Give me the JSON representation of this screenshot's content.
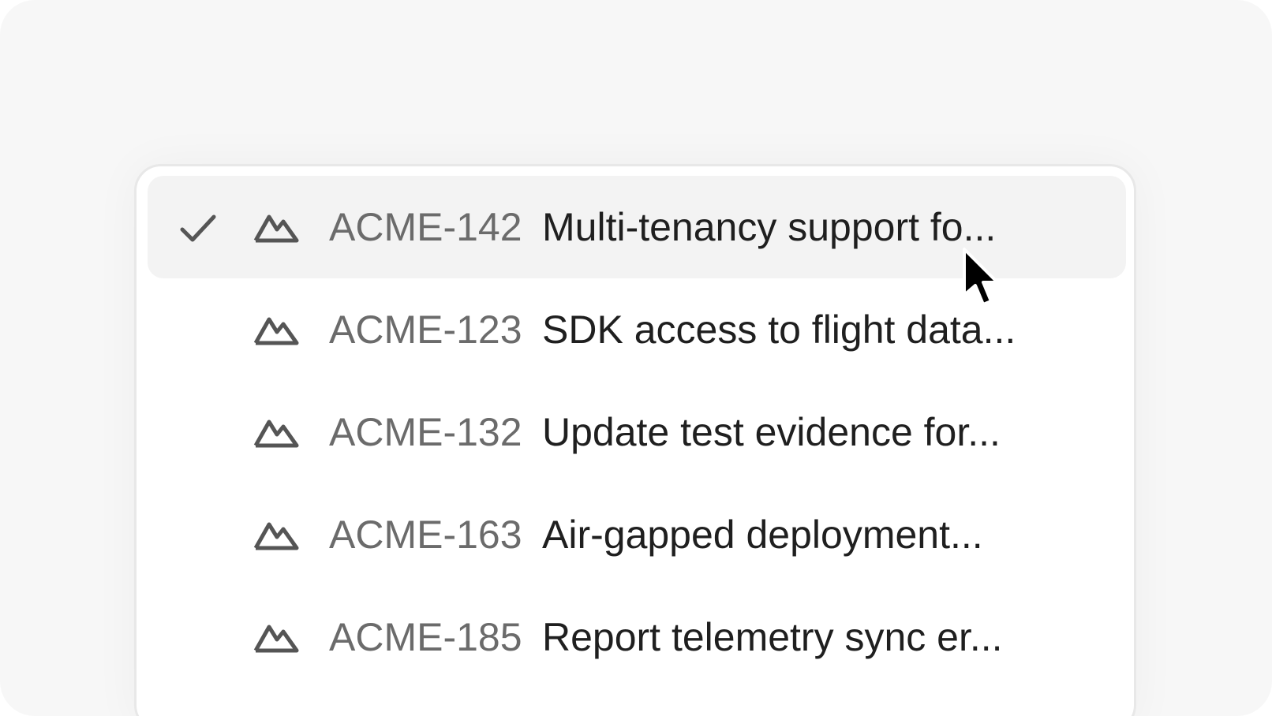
{
  "menu": {
    "items": [
      {
        "id": "ACME-142",
        "title": "Multi-tenancy support fo...",
        "selected": true,
        "icon": "mountain-icon"
      },
      {
        "id": "ACME-123",
        "title": "SDK access to flight data...",
        "selected": false,
        "icon": "mountain-icon"
      },
      {
        "id": "ACME-132",
        "title": "Update test evidence for...",
        "selected": false,
        "icon": "mountain-icon"
      },
      {
        "id": "ACME-163",
        "title": "Air-gapped deployment...",
        "selected": false,
        "icon": "mountain-icon"
      },
      {
        "id": "ACME-185",
        "title": "Report telemetry sync er...",
        "selected": false,
        "icon": "mountain-icon"
      }
    ]
  },
  "colors": {
    "background": "#f7f7f7",
    "panel": "#ffffff",
    "selected_row": "#f3f3f3",
    "id_text": "#6b6b6b",
    "title_text": "#1f1f1f",
    "icon": "#555555"
  }
}
